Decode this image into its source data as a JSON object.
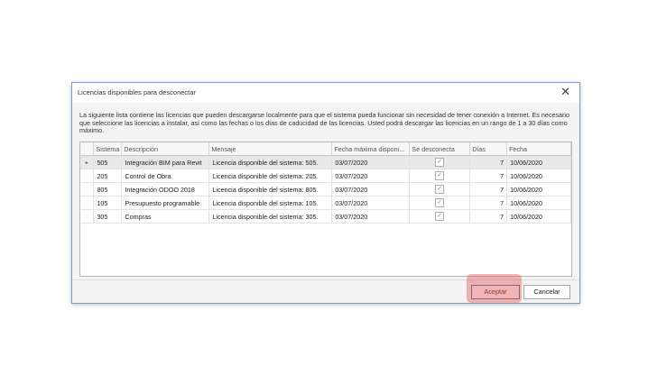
{
  "dialog": {
    "title": "Licencias disponibles para desconectar",
    "close_symbol": "✕",
    "description": "La siguiente lista contiene las licencias que pueden descargarse localmente para que el sistema pueda funcionar sin necesidad de tener conexión a Internet. Es necesario que seleccione las licencias a instalar, así como las fechas o los días de caducidad de las licencias. Usted podrá descargar las licencias en un rango de 1 a 30 días como máximo."
  },
  "grid": {
    "columns": [
      "Sistema",
      "Descripción",
      "Mensaje",
      "Fecha máxima disponi...",
      "Se desconecta",
      "Días",
      "Fecha"
    ],
    "row_indicator": "▸",
    "rows": [
      {
        "sistema": "505",
        "descripcion": "Integración BIM para Revit",
        "mensaje": "Licencia disponible del sistema: 505.",
        "fecha_max": "03/07/2020",
        "se_desconecta": true,
        "dias": "7",
        "fecha": "10/06/2020",
        "selected": true
      },
      {
        "sistema": "205",
        "descripcion": "Control de Obra",
        "mensaje": "Licencia disponible del sistema: 205.",
        "fecha_max": "03/07/2020",
        "se_desconecta": true,
        "dias": "7",
        "fecha": "10/06/2020",
        "selected": false
      },
      {
        "sistema": "805",
        "descripcion": "Integración ODOO 2018",
        "mensaje": "Licencia disponible del sistema: 805.",
        "fecha_max": "03/07/2020",
        "se_desconecta": true,
        "dias": "7",
        "fecha": "10/06/2020",
        "selected": false
      },
      {
        "sistema": "105",
        "descripcion": "Presupuesto programable",
        "mensaje": "Licencia disponible del sistema: 105.",
        "fecha_max": "03/07/2020",
        "se_desconecta": true,
        "dias": "7",
        "fecha": "10/06/2020",
        "selected": false
      },
      {
        "sistema": "305",
        "descripcion": "Compras",
        "mensaje": "Licencia disponible del sistema: 305.",
        "fecha_max": "03/07/2020",
        "se_desconecta": true,
        "dias": "7",
        "fecha": "10/06/2020",
        "selected": false
      }
    ]
  },
  "buttons": {
    "accept_label": "Aceptar",
    "cancel_label": "Cancelar"
  },
  "colors": {
    "highlight": "#e45a5a",
    "dialog_border": "#7a9cc6"
  }
}
